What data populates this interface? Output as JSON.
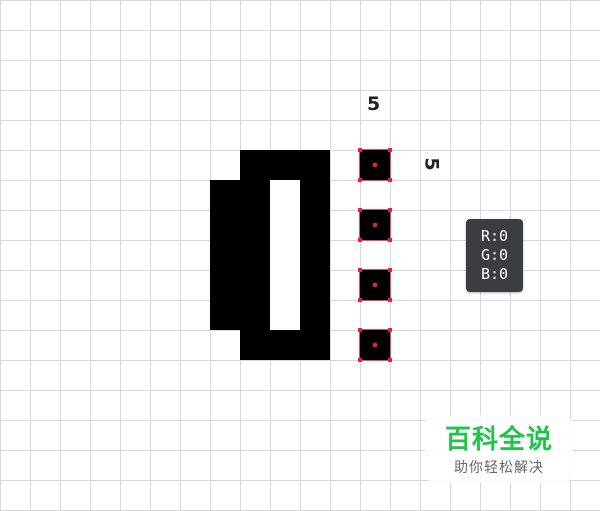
{
  "canvas": {
    "grid_color": "#d8d8d8",
    "background": "#ffffff"
  },
  "artwork": {
    "fill_color": "#000000"
  },
  "selection": {
    "anchor_color": "#e5223a",
    "count": 4
  },
  "dimensions": {
    "top_label": "5",
    "right_label": "5"
  },
  "color_tooltip": {
    "r": "R:0",
    "g": "G:0",
    "b": "B:0"
  },
  "watermark": {
    "title": "百科全说",
    "subtitle": "助你轻松解决",
    "title_color": "#20c34a"
  }
}
